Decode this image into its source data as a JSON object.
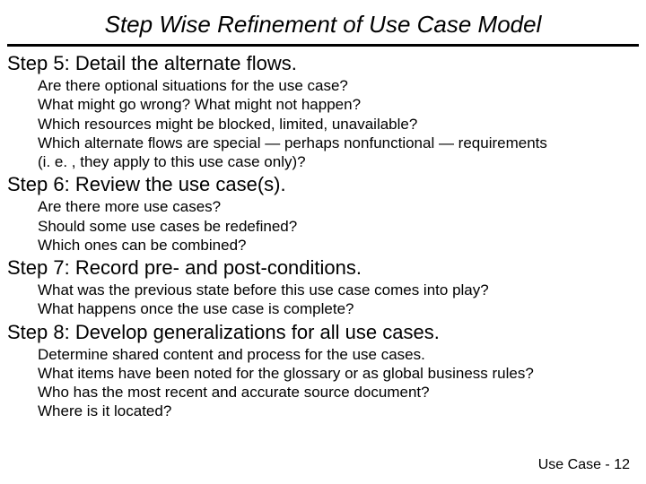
{
  "title": "Step Wise Refinement of Use Case Model",
  "steps": [
    {
      "heading": "Step 5: Detail the alternate flows.",
      "lines": [
        "Are there optional situations for the use case?",
        "What might go wrong?  What might not happen?",
        "Which resources might be blocked, limited, unavailable?",
        "Which alternate flows are special — perhaps nonfunctional — requirements",
        "(i. e. , they apply to this use case only)?"
      ]
    },
    {
      "heading": "Step 6: Review the use case(s).",
      "lines": [
        "Are there more use cases?",
        "Should some use cases be redefined?",
        "Which ones can be combined?"
      ]
    },
    {
      "heading": "Step 7: Record pre- and post-conditions.",
      "lines": [
        "What was the previous state before this use case comes into play?",
        "What happens once the use case is complete?"
      ]
    },
    {
      "heading": "Step 8: Develop generalizations for all use cases.",
      "lines": [
        "Determine shared content and process for the use cases.",
        "What items have been noted for the glossary or as global business rules?",
        "Who has the most recent and accurate source document?",
        "Where is it located?"
      ]
    }
  ],
  "footer": "Use Case - 12"
}
